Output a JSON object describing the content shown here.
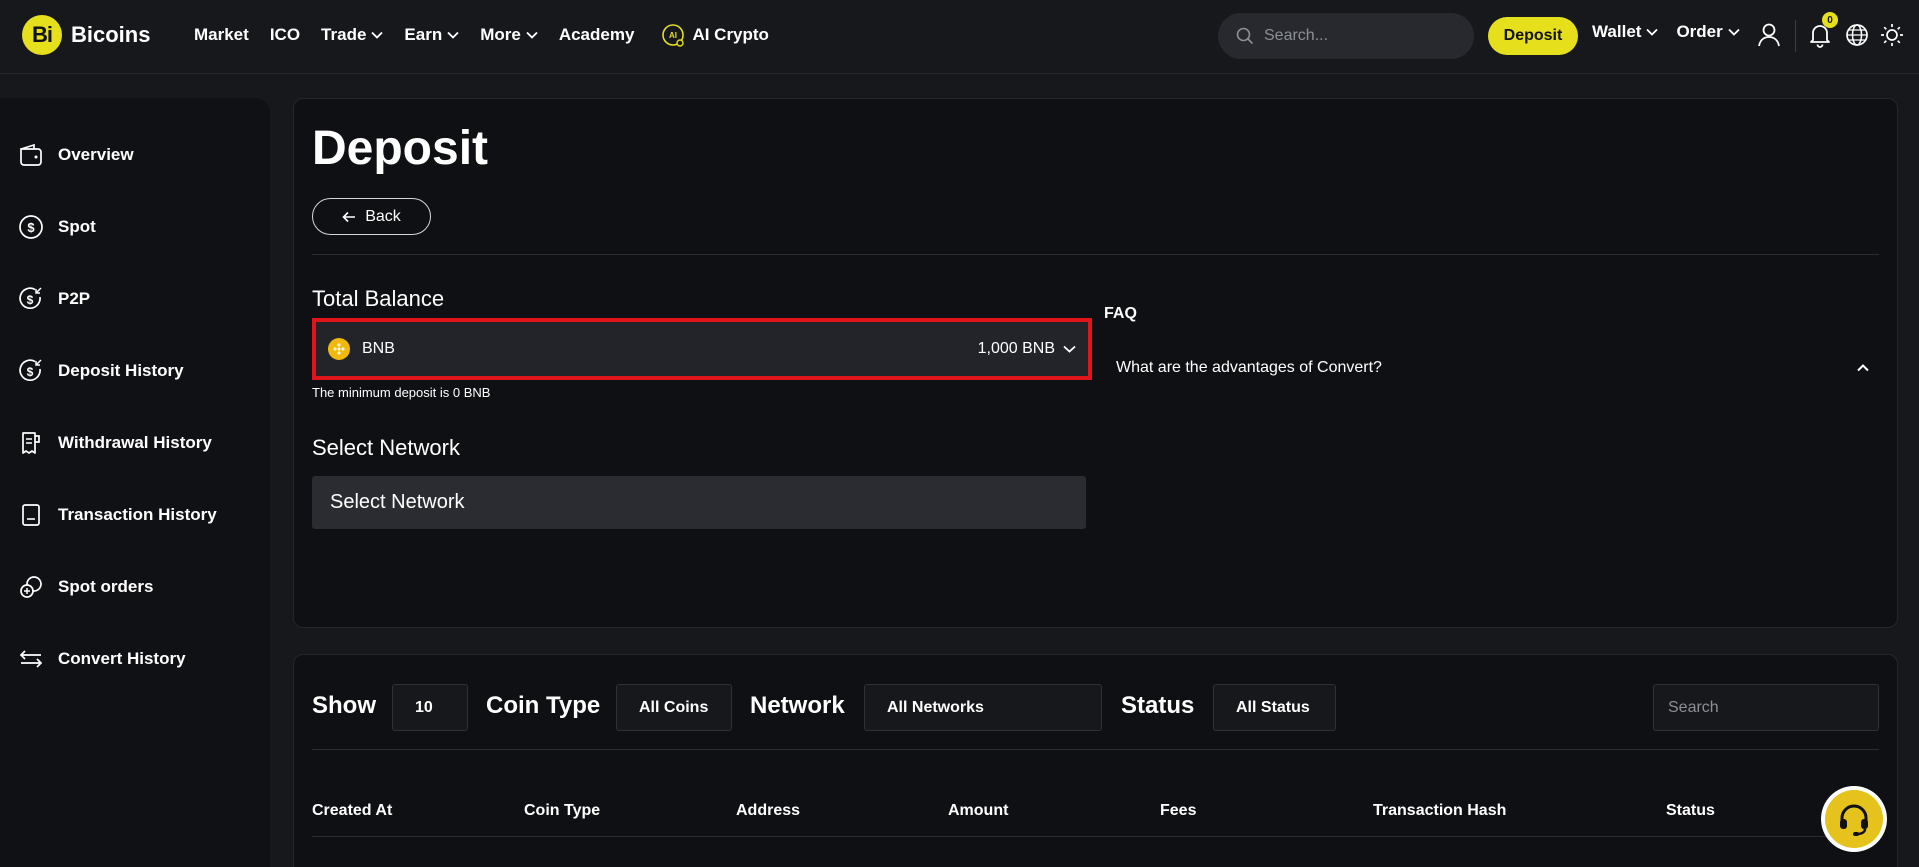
{
  "brand": {
    "logo_mark": "Bi",
    "name": "Bicoins",
    "accent_color": "#e6e01c"
  },
  "nav": {
    "links": [
      {
        "label": "Market",
        "dropdown": false
      },
      {
        "label": "ICO",
        "dropdown": false
      },
      {
        "label": "Trade",
        "dropdown": true
      },
      {
        "label": "Earn",
        "dropdown": true
      },
      {
        "label": "More",
        "dropdown": true
      },
      {
        "label": "Academy",
        "dropdown": false
      }
    ],
    "ai_crypto_label": "AI Crypto",
    "search_placeholder": "Search...",
    "deposit_label": "Deposit",
    "wallet_label": "Wallet",
    "order_label": "Order",
    "notification_count": "0",
    "icons": [
      "user-icon",
      "bell-icon",
      "globe-icon",
      "sun-icon"
    ]
  },
  "sidebar": {
    "items": [
      {
        "label": "Overview",
        "icon": "wallet-icon"
      },
      {
        "label": "Spot",
        "icon": "dollar-coin-icon"
      },
      {
        "label": "P2P",
        "icon": "p2p-icon"
      },
      {
        "label": "Deposit History",
        "icon": "deposit-history-icon"
      },
      {
        "label": "Withdrawal History",
        "icon": "withdrawal-history-icon"
      },
      {
        "label": "Transaction History",
        "icon": "receipt-icon"
      },
      {
        "label": "Spot orders",
        "icon": "spot-orders-icon"
      },
      {
        "label": "Convert History",
        "icon": "convert-arrows-icon"
      }
    ]
  },
  "deposit": {
    "title": "Deposit",
    "back_label": "Back",
    "total_balance_label": "Total Balance",
    "selected_coin": {
      "symbol": "BNB",
      "balance": "1,000 BNB",
      "icon_color": "#f0b90b"
    },
    "min_deposit_note": "The minimum deposit is 0 BNB",
    "select_network_label": "Select Network",
    "network_placeholder": "Select Network",
    "highlight_color": "#e0141b"
  },
  "faq": {
    "title": "FAQ",
    "items": [
      {
        "question": "What are the advantages of Convert?",
        "expanded": true
      }
    ]
  },
  "history_table": {
    "filters": {
      "show_label": "Show",
      "show_value": "10",
      "coin_type_label": "Coin Type",
      "coin_type_value": "All Coins",
      "network_label": "Network",
      "network_value": "All Networks",
      "status_label": "Status",
      "status_value": "All Status",
      "search_placeholder": "Search"
    },
    "columns": [
      "Created At",
      "Coin Type",
      "Address",
      "Amount",
      "Fees",
      "Transaction Hash",
      "Status"
    ]
  }
}
